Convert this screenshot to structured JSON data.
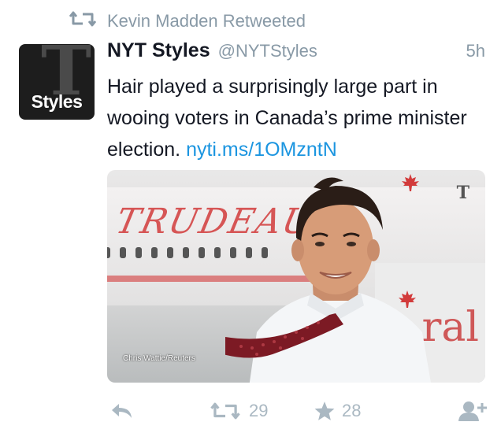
{
  "retweet_context": {
    "label": "Kevin Madden Retweeted"
  },
  "author": {
    "avatar_text": "Styles",
    "avatar_glyph": "T",
    "display_name": "NYT Styles",
    "handle": "@NYTStyles"
  },
  "timestamp": "5h",
  "tweet": {
    "text": "Hair played a surprisingly large part in wooing voters in Canada’s prime minister election.",
    "link": "nyti.ms/1OMzntN"
  },
  "media": {
    "plane_text": "TRUDEAU",
    "tail_text": "ral",
    "watermark": "T",
    "credit": "Chris Wattie/Reuters"
  },
  "actions": {
    "retweet_count": "29",
    "like_count": "28"
  },
  "colors": {
    "text": "#141823",
    "secondary": "#8899a6",
    "link": "#1b95e0",
    "action_icon": "#aab8c2"
  },
  "icons": [
    "retweet-icon",
    "reply-icon",
    "star-icon",
    "follow-icon"
  ]
}
